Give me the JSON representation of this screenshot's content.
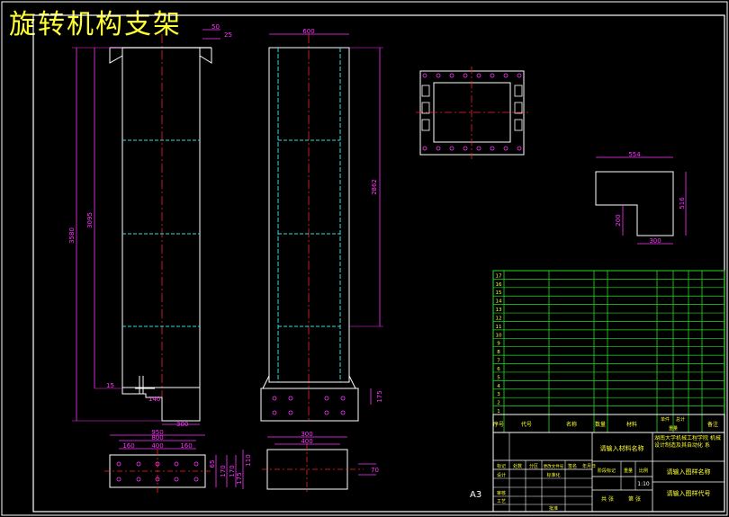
{
  "drawing": {
    "title": "旋转机构支架",
    "colors": {
      "background": "#000000",
      "title": "#ffff33",
      "outline": "#ffffff",
      "dimension": "#ff33ff",
      "centerline": "#ff2222",
      "hidden": "#33dddd",
      "table": "#22dd22",
      "table_text": "#ffff33"
    },
    "front_view": {
      "dims": [
        "3580",
        "3095",
        "15",
        "140",
        "300",
        "50",
        "25"
      ]
    },
    "side_view": {
      "dims": [
        "600",
        "2862",
        "175"
      ]
    },
    "bottom_left": {
      "dims": [
        "950",
        "800",
        "160",
        "400",
        "160",
        "65",
        "170",
        "170"
      ]
    },
    "bottom_mid": {
      "dims": [
        "300",
        "400",
        "70",
        "175",
        "110"
      ]
    },
    "bracket": {
      "dims": [
        "554",
        "200",
        "300",
        "516"
      ]
    },
    "mark": "A3",
    "parts_rows": [
      "17",
      "16",
      "15",
      "14",
      "13",
      "12",
      "11",
      "10",
      "9",
      "8",
      "7",
      "6",
      "5",
      "4",
      "3",
      "2",
      "1"
    ],
    "title_block": {
      "header": [
        "序号",
        "代号",
        "名称",
        "数量",
        "材料",
        "单件",
        "总计",
        "重量",
        "备注"
      ],
      "material": "请输入材料名称",
      "company": "湖南大学机械工程学院 机械设计制造及其自动化 系",
      "drawing_name": "请输入图样名称",
      "drawing_code": "请输入图样代号",
      "scale_ratio": "1:10",
      "scale_labels": [
        "阶段标记",
        "重量",
        "比例"
      ],
      "sheet_labels": [
        "共 张",
        "第 张"
      ],
      "row_labels": [
        "标记",
        "处数",
        "分区",
        "更改文件号",
        "签名",
        "年月日"
      ],
      "signer_labels": [
        "设计",
        "标准化",
        "审核",
        "工艺",
        "批准"
      ]
    }
  }
}
